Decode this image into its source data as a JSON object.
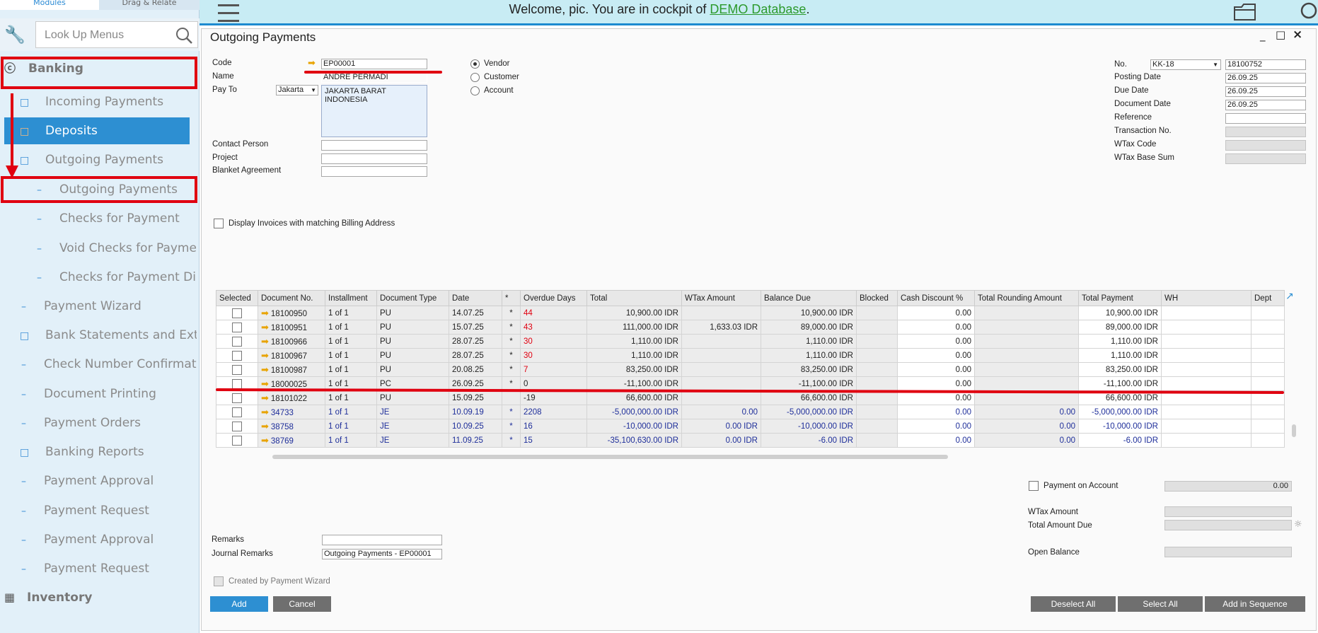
{
  "nav": {
    "tab_modules": "Modules",
    "tab_drag": "Drag & Relate",
    "lookup_placeholder": "Look Up Menus",
    "items": [
      {
        "label": "Banking"
      },
      {
        "label": "Incoming Payments"
      },
      {
        "label": "Deposits"
      },
      {
        "label": "Outgoing Payments"
      },
      {
        "label": "Outgoing Payments"
      },
      {
        "label": "Checks for Payment"
      },
      {
        "label": "Void Checks for Payme"
      },
      {
        "label": "Checks for Payment Di"
      },
      {
        "label": "Payment Wizard"
      },
      {
        "label": "Bank Statements and Ext"
      },
      {
        "label": "Check Number Confirmat"
      },
      {
        "label": "Document Printing"
      },
      {
        "label": "Payment Orders"
      },
      {
        "label": "Banking Reports"
      },
      {
        "label": "Payment Approval"
      },
      {
        "label": "Payment Request"
      },
      {
        "label": "Payment Approval"
      },
      {
        "label": "Payment Request"
      },
      {
        "label": "Inventory"
      }
    ]
  },
  "header": {
    "welcome_prefix": "Welcome, pic. You are in cockpit of ",
    "db_name": "DEMO Database",
    "welcome_suffix": "."
  },
  "form": {
    "title": "Outgoing Payments",
    "labels": {
      "code": "Code",
      "name": "Name",
      "pay_to": "Pay To",
      "contact": "Contact Person",
      "project": "Project",
      "blanket": "Blanket Agreement",
      "no": "No.",
      "posting": "Posting Date",
      "due": "Due Date",
      "docdate": "Document Date",
      "reference": "Reference",
      "trans": "Transaction No.",
      "wtax_code": "WTax Code",
      "wtax_base": "WTax Base Sum"
    },
    "values": {
      "code": "EP00001",
      "name": "ANDRE PERMADI",
      "payto_select": "Jakarta",
      "address_line1": "JAKARTA BARAT",
      "address_line2": "INDONESIA",
      "series": "KK-18",
      "doc_no": "18100752",
      "posting": "26.09.25",
      "due": "26.09.25",
      "docdate": "26.09.25"
    },
    "radios": {
      "vendor": "Vendor",
      "customer": "Customer",
      "account": "Account"
    },
    "display_invoices": "Display Invoices with matching Billing Address",
    "columns": [
      "Selected",
      "Document No.",
      "Installment",
      "Document Type",
      "Date",
      "*",
      "Overdue Days",
      "Total",
      "WTax Amount",
      "Balance Due",
      "Blocked",
      "Cash Discount %",
      "Total Rounding Amount",
      "Total Payment",
      "WH",
      "Dept"
    ],
    "rows": [
      {
        "doc": "18100950",
        "inst": "1 of 1",
        "type": "PU",
        "date": "14.07.25",
        "star": "*",
        "od": "44",
        "total": "10,900.00 IDR",
        "wtax": "",
        "bal": "10,900.00 IDR",
        "disc": "0.00",
        "round": "",
        "pay": "10,900.00 IDR"
      },
      {
        "doc": "18100951",
        "inst": "1 of 1",
        "type": "PU",
        "date": "15.07.25",
        "star": "*",
        "od": "43",
        "total": "111,000.00 IDR",
        "wtax": "1,633.03 IDR",
        "bal": "89,000.00 IDR",
        "disc": "0.00",
        "round": "",
        "pay": "89,000.00 IDR"
      },
      {
        "doc": "18100966",
        "inst": "1 of 1",
        "type": "PU",
        "date": "28.07.25",
        "star": "*",
        "od": "30",
        "total": "1,110.00 IDR",
        "wtax": "",
        "bal": "1,110.00 IDR",
        "disc": "0.00",
        "round": "",
        "pay": "1,110.00 IDR"
      },
      {
        "doc": "18100967",
        "inst": "1 of 1",
        "type": "PU",
        "date": "28.07.25",
        "star": "*",
        "od": "30",
        "total": "1,110.00 IDR",
        "wtax": "",
        "bal": "1,110.00 IDR",
        "disc": "0.00",
        "round": "",
        "pay": "1,110.00 IDR"
      },
      {
        "doc": "18100987",
        "inst": "1 of 1",
        "type": "PU",
        "date": "20.08.25",
        "star": "*",
        "od": "7",
        "total": "83,250.00 IDR",
        "wtax": "",
        "bal": "83,250.00 IDR",
        "disc": "0.00",
        "round": "",
        "pay": "83,250.00 IDR"
      },
      {
        "doc": "18000025",
        "inst": "1 of 1",
        "type": "PC",
        "date": "26.09.25",
        "star": "*",
        "od": "0",
        "total": "-11,100.00 IDR",
        "wtax": "",
        "bal": "-11,100.00 IDR",
        "disc": "0.00",
        "round": "",
        "pay": "-11,100.00 IDR"
      },
      {
        "doc": "18101022",
        "inst": "1 of 1",
        "type": "PU",
        "date": "15.09.25",
        "star": "",
        "od": "-19",
        "total": "66,600.00 IDR",
        "wtax": "",
        "bal": "66,600.00 IDR",
        "disc": "0.00",
        "round": "",
        "pay": "66,600.00 IDR"
      },
      {
        "doc": "34733",
        "inst": "1 of 1",
        "type": "JE",
        "date": "10.09.19",
        "star": "*",
        "od": "2208",
        "total": "-5,000,000.00 IDR",
        "wtax": "0.00",
        "bal": "-5,000,000.00 IDR",
        "disc": "0.00",
        "round": "0.00",
        "pay": "-5,000,000.00 IDR"
      },
      {
        "doc": "38758",
        "inst": "1 of 1",
        "type": "JE",
        "date": "10.09.25",
        "star": "*",
        "od": "16",
        "total": "-10,000.00 IDR",
        "wtax": "0.00 IDR",
        "bal": "-10,000.00 IDR",
        "disc": "0.00",
        "round": "0.00",
        "pay": "-10,000.00 IDR"
      },
      {
        "doc": "38769",
        "inst": "1 of 1",
        "type": "JE",
        "date": "11.09.25",
        "star": "*",
        "od": "15",
        "total": "-35,100,630.00 IDR",
        "wtax": "0.00 IDR",
        "bal": "-6.00 IDR",
        "disc": "0.00",
        "round": "0.00",
        "pay": "-6.00 IDR"
      }
    ],
    "payment_on_account": "Payment on Account",
    "payment_on_account_value": "0.00",
    "wtax_amount": "WTax Amount",
    "total_amount_due": "Total Amount Due",
    "open_balance": "Open Balance",
    "remarks": "Remarks",
    "journal_remarks": "Journal Remarks",
    "journal_remarks_value": "Outgoing Payments - EP00001",
    "created_by_wizard": "Created by Payment Wizard",
    "buttons": {
      "add": "Add",
      "cancel": "Cancel",
      "deselect": "Deselect All",
      "select": "Select All",
      "seq": "Add in Sequence"
    }
  }
}
